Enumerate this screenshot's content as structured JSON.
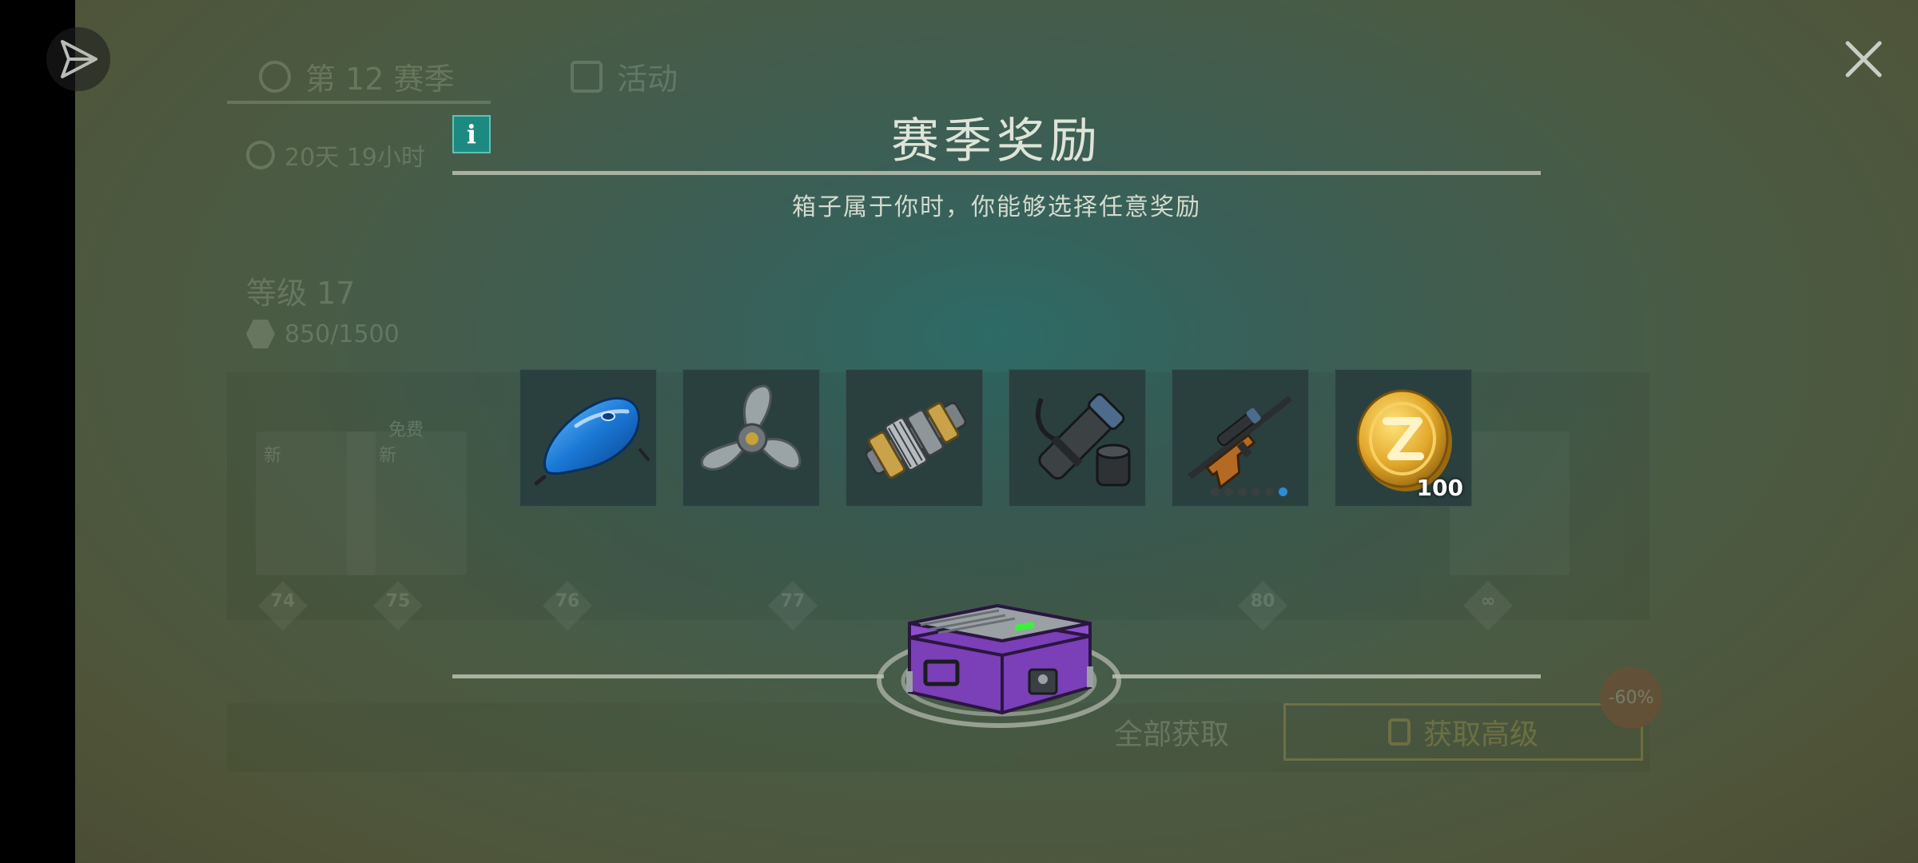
{
  "background": {
    "tabs": [
      {
        "label": "第 12 赛季",
        "icon": "season-icon"
      },
      {
        "label": "活动",
        "icon": "calendar-icon"
      }
    ],
    "timer": "20天 19小时",
    "level": "等级 17",
    "xp": "850/1500",
    "card_tags": [
      "新",
      "新",
      "免费"
    ],
    "milestones": [
      "74",
      "75",
      "76",
      "77",
      "80",
      "∞"
    ],
    "claim_all_label": "全部获取",
    "get_premium_label": "获取高级",
    "discount_badge": "-60%"
  },
  "icons": {
    "send": "send-icon",
    "close": "close-icon",
    "info": "info-icon",
    "info_glyph": "i"
  },
  "modal": {
    "title": "赛季奖励",
    "subtitle": "箱子属于你时，你能够选择任意奖励",
    "rewards": [
      {
        "name": "fuel-tank",
        "icon": "fuel-tank-icon"
      },
      {
        "name": "propeller",
        "icon": "propeller-icon"
      },
      {
        "name": "gear-shaft",
        "icon": "gear-shaft-icon"
      },
      {
        "name": "scope-attachment",
        "icon": "scope-icon"
      },
      {
        "name": "sniper-rifle",
        "icon": "sniper-rifle-icon",
        "rank_total": 6,
        "rank_filled": 1
      },
      {
        "name": "coin",
        "icon": "coin-icon",
        "quantity": "100"
      }
    ],
    "chest_icon": "purple-chest-icon"
  },
  "colors": {
    "accent_teal": "#1c8a80",
    "slot_bg": "#29403f",
    "premium_gold": "#e3c04a",
    "chest_purple": "#7b3fb8"
  }
}
